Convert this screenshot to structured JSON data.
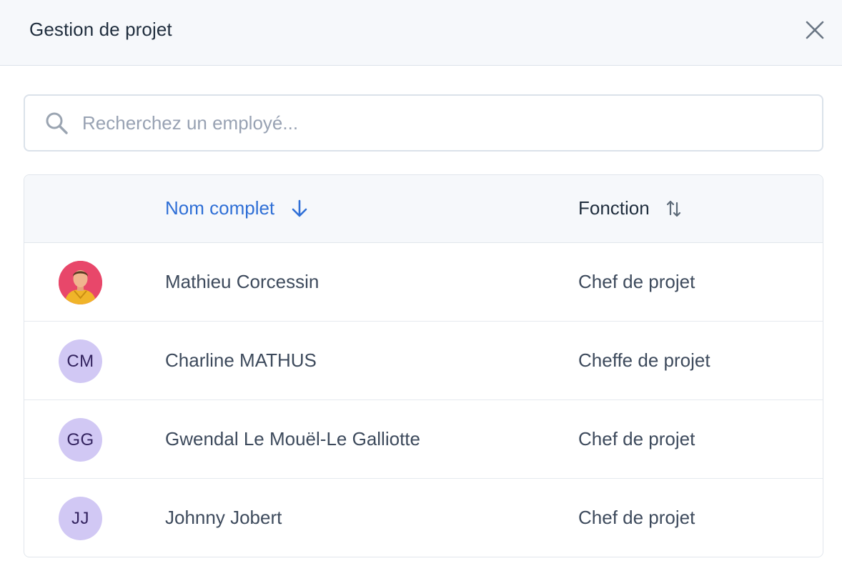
{
  "header": {
    "title": "Gestion de projet"
  },
  "icons": {
    "close": "close-icon",
    "search": "search-icon",
    "sort_desc": "arrow-down-icon",
    "sort_both": "sort-arrows-icon"
  },
  "search": {
    "placeholder": "Recherchez un employé...",
    "value": ""
  },
  "table": {
    "columns": [
      {
        "label": "Nom complet",
        "sort": "descending"
      },
      {
        "label": "Fonction",
        "sort": "none"
      }
    ],
    "rows": [
      {
        "initials": "",
        "avatar": "photo",
        "name": "Mathieu Corcessin",
        "function": "Chef de projet"
      },
      {
        "initials": "CM",
        "avatar": "initials",
        "name": "Charline MATHUS",
        "function": "Cheffe de projet"
      },
      {
        "initials": "GG",
        "avatar": "initials",
        "name": "Gwendal Le Mouël-Le Galliotte",
        "function": "Chef de projet"
      },
      {
        "initials": "JJ",
        "avatar": "initials",
        "name": "Johnny Jobert",
        "function": "Chef de projet"
      }
    ]
  },
  "colors": {
    "accent": "#2f6fd6",
    "avatar_bg": "#d1c8f4",
    "avatar_text": "#33235f",
    "header_bg": "#f6f8fb"
  }
}
